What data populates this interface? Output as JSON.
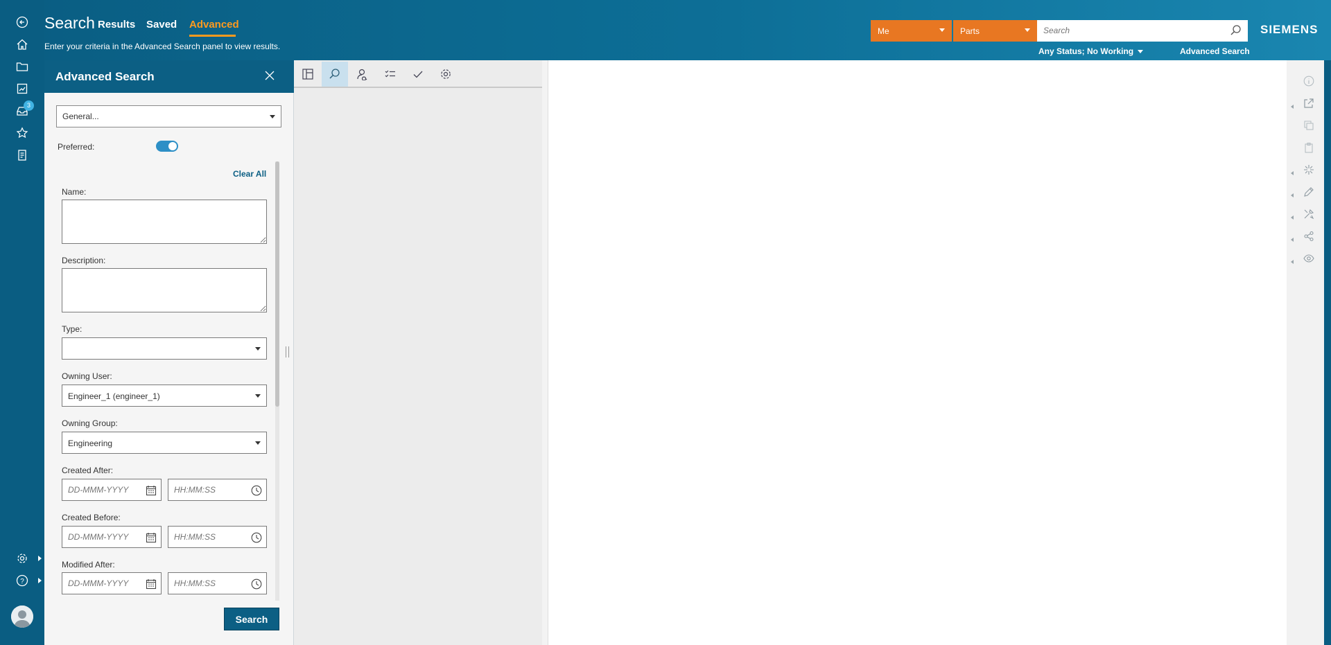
{
  "header": {
    "title": "Search",
    "tabs": [
      {
        "label": "Results",
        "active": false
      },
      {
        "label": "Saved",
        "active": false
      },
      {
        "label": "Advanced",
        "active": true
      }
    ],
    "hint": "Enter your criteria in the Advanced Search panel to view results.",
    "context": {
      "user": "Me",
      "type": "Parts"
    },
    "search_placeholder": "Search",
    "brand": "SIEMENS",
    "status_filter": "Any Status; No Working",
    "advanced_link": "Advanced Search"
  },
  "left_rail": {
    "items": [
      "back-icon",
      "home-icon",
      "folder-icon",
      "changes-icon",
      "inbox-icon",
      "favorites-icon",
      "history-icon"
    ],
    "inbox_badge": "3",
    "bottom": [
      "settings-icon",
      "help-icon",
      "avatar"
    ]
  },
  "panel": {
    "title": "Advanced Search",
    "template": "General...",
    "preferred_label": "Preferred:",
    "preferred_on": true,
    "clear_all": "Clear All",
    "fields": {
      "name_label": "Name:",
      "description_label": "Description:",
      "type_label": "Type:",
      "type_value": "",
      "owning_user_label": "Owning User:",
      "owning_user_value": "Engineer_1 (engineer_1)",
      "owning_group_label": "Owning Group:",
      "owning_group_value": "Engineering",
      "created_after_label": "Created After:",
      "created_before_label": "Created Before:",
      "modified_after_label": "Modified After:",
      "date_placeholder": "DD-MMM-YYYY",
      "time_placeholder": "HH:MM:SS"
    },
    "search_button": "Search"
  },
  "toolbar": {
    "buttons": [
      "layout-icon",
      "search-icon",
      "person-search-icon",
      "checklist-icon",
      "check-icon",
      "gear-icon"
    ],
    "active": "search-icon"
  },
  "right_rail": {
    "icons": [
      "info-icon",
      "share-out-icon",
      "copy-icon",
      "paste-icon",
      "sparkle-icon",
      "edit-icon",
      "tools-icon",
      "share-icon",
      "eye-icon"
    ]
  },
  "colors": {
    "header": "#0a5d82",
    "accent_orange": "#e87722",
    "active_tab": "#ff9a1e",
    "primary_button": "#0c5f84"
  }
}
